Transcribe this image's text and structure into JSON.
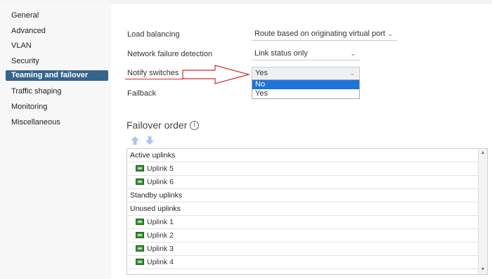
{
  "sidebar": {
    "items": [
      {
        "label": "General"
      },
      {
        "label": "Advanced"
      },
      {
        "label": "VLAN"
      },
      {
        "label": "Security"
      },
      {
        "label": "Teaming and failover",
        "active": true
      },
      {
        "label": "Traffic shaping"
      },
      {
        "label": "Monitoring"
      },
      {
        "label": "Miscellaneous"
      }
    ]
  },
  "form": {
    "load_balancing": {
      "label": "Load balancing",
      "value": "Route based on originating virtual port"
    },
    "network_failure_detection": {
      "label": "Network failure detection",
      "value": "Link status only"
    },
    "notify_switches": {
      "label": "Notify switches",
      "value": "Yes",
      "options": [
        "No",
        "Yes"
      ],
      "highlighted": "No"
    },
    "failback": {
      "label": "Failback"
    }
  },
  "failover": {
    "title": "Failover order",
    "groups": {
      "active": {
        "label": "Active uplinks",
        "items": [
          "Uplink 5",
          "Uplink 6"
        ]
      },
      "standby": {
        "label": "Standby uplinks"
      },
      "unused": {
        "label": "Unused uplinks",
        "items": [
          "Uplink 1",
          "Uplink 2",
          "Uplink 3",
          "Uplink 4"
        ]
      }
    }
  },
  "icons": {
    "move_up": "arrow-up-icon",
    "move_down": "arrow-down-icon",
    "info": "info-icon",
    "uplink": "uplink-icon",
    "chevron": "chevron-down-icon"
  },
  "colors": {
    "active_item": "#36648b",
    "highlight": "#1e74d8",
    "annotation": "#d12b2b",
    "uplink_icon": "#3a8f3a"
  }
}
